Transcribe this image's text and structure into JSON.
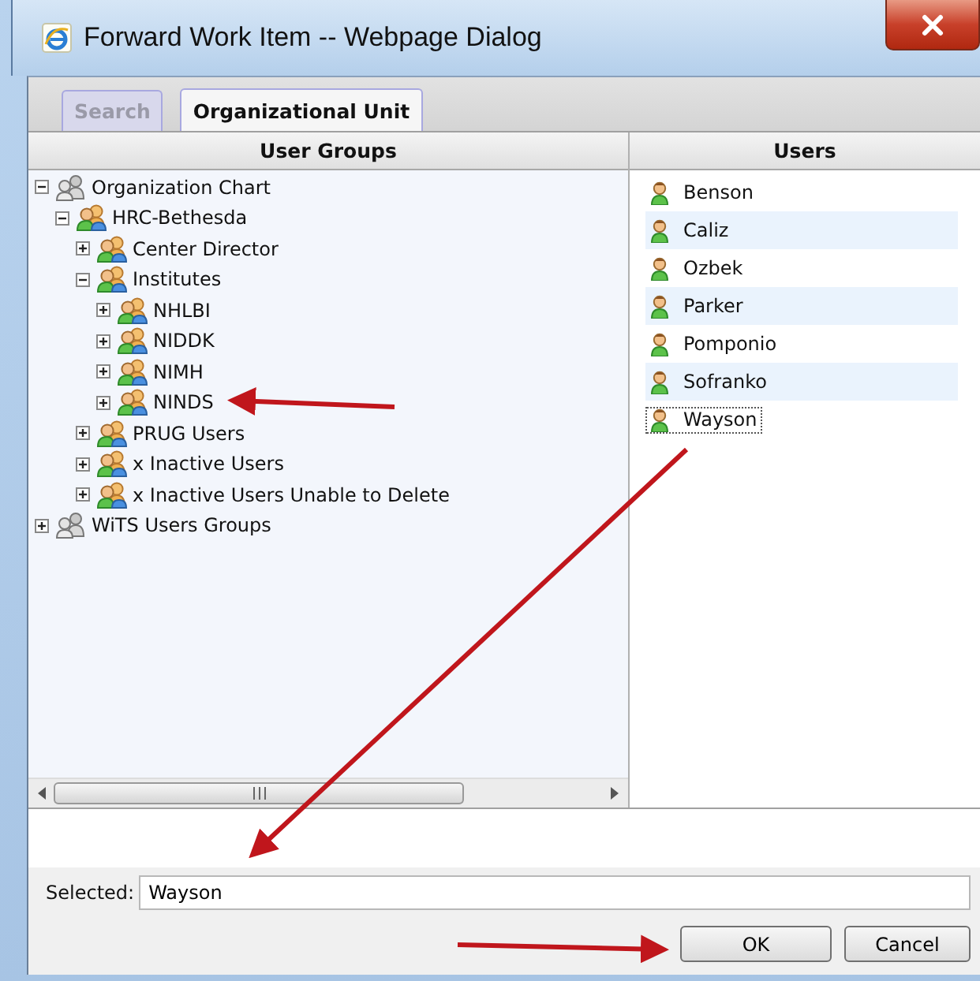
{
  "window": {
    "title": "Forward Work Item -- Webpage Dialog"
  },
  "tabs": [
    {
      "label": "Search",
      "selected": false
    },
    {
      "label": "Organizational Unit",
      "selected": true
    }
  ],
  "columns": [
    "User Groups",
    "Users"
  ],
  "tree": [
    {
      "label": "Organization Chart",
      "kind": "org",
      "expanded": true,
      "children": [
        {
          "label": "HRC-Bethesda",
          "kind": "group",
          "expanded": true,
          "children": [
            {
              "label": "Center Director",
              "kind": "group",
              "expanded": false
            },
            {
              "label": "Institutes",
              "kind": "group",
              "expanded": true,
              "children": [
                {
                  "label": "NHLBI",
                  "kind": "group",
                  "expanded": false
                },
                {
                  "label": "NIDDK",
                  "kind": "group",
                  "expanded": false
                },
                {
                  "label": "NIMH",
                  "kind": "group",
                  "expanded": false
                },
                {
                  "label": "NINDS",
                  "kind": "group",
                  "expanded": false
                }
              ]
            },
            {
              "label": "PRUG Users",
              "kind": "group",
              "expanded": false
            },
            {
              "label": "x Inactive Users",
              "kind": "group",
              "expanded": false
            },
            {
              "label": "x Inactive Users Unable to Delete",
              "kind": "group",
              "expanded": false
            }
          ]
        }
      ]
    },
    {
      "label": "WiTS Users Groups",
      "kind": "org",
      "expanded": false
    }
  ],
  "users": [
    {
      "name": "Benson",
      "selected": false
    },
    {
      "name": "Caliz",
      "selected": false
    },
    {
      "name": "Ozbek",
      "selected": false
    },
    {
      "name": "Parker",
      "selected": false
    },
    {
      "name": "Pomponio",
      "selected": false
    },
    {
      "name": "Sofranko",
      "selected": false
    },
    {
      "name": "Wayson",
      "selected": true
    }
  ],
  "selected_field": {
    "label": "Selected:",
    "value": "Wayson"
  },
  "buttons": [
    "OK",
    "Cancel"
  ]
}
